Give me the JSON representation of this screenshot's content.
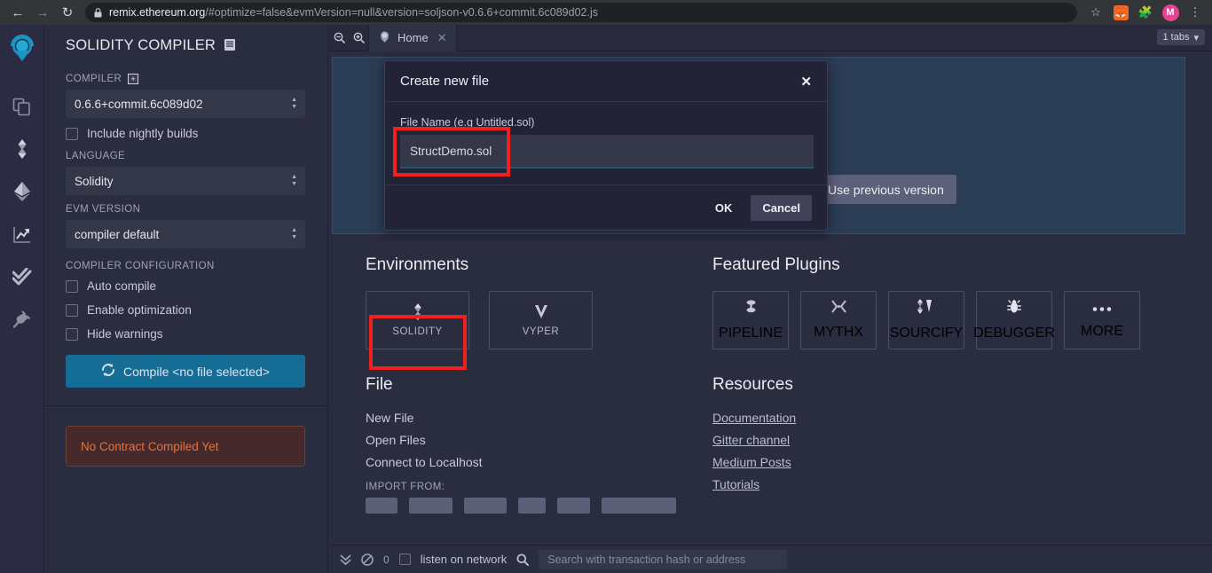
{
  "browser": {
    "back_icon": "back-arrow-icon",
    "forward_icon": "forward-arrow-icon",
    "reload_icon": "reload-icon",
    "lock_icon": "lock-icon",
    "url_host": "remix.ethereum.org",
    "url_rest": "/#optimize=false&evmVersion=null&version=soljson-v0.6.6+commit.6c089d02.js",
    "bookmark_icon": "star-icon",
    "metamask_icon": "metamask-fox-icon",
    "extensions_icon": "puzzle-piece-icon",
    "profile_initial": "M",
    "menu_icon": "kebab-menu-icon"
  },
  "rail": {
    "logo": "remix-logo-icon",
    "items": [
      {
        "name": "file-explorers",
        "icon": "files-icon"
      },
      {
        "name": "solidity-compiler",
        "icon": "solidity-icon"
      },
      {
        "name": "deploy-run-transactions",
        "icon": "ethereum-icon"
      },
      {
        "name": "solidity-static-analysis",
        "icon": "analytics-chart-icon"
      },
      {
        "name": "solidity-unit-testing",
        "icon": "double-check-icon"
      },
      {
        "name": "plugin-manager",
        "icon": "plug-icon"
      }
    ]
  },
  "panel": {
    "title": "SOLIDITY COMPILER",
    "title_icon": "book-doc-icon",
    "compiler_label": "COMPILER",
    "compiler_label_icon": "plus-box-icon",
    "compiler_value": "0.6.6+commit.6c089d02",
    "nightly_label": "Include nightly builds",
    "nightly_checked": false,
    "language_label": "LANGUAGE",
    "language_value": "Solidity",
    "evm_label": "EVM VERSION",
    "evm_value": "compiler default",
    "config_label": "COMPILER CONFIGURATION",
    "config_options": [
      {
        "label": "Auto compile",
        "checked": false
      },
      {
        "label": "Enable optimization",
        "checked": false
      },
      {
        "label": "Hide warnings",
        "checked": false
      }
    ],
    "compile_icon": "refresh-icon",
    "compile_label": "Compile <no file selected>",
    "status_text": "No Contract Compiled Yet"
  },
  "tabbar": {
    "zoom_out_icon": "zoom-out-icon",
    "zoom_in_icon": "zoom-in-icon",
    "tab_icon": "remix-home-icon",
    "tab_label": "Home",
    "tab_close_icon": "close-icon",
    "tabs_count_label": "1 tabs",
    "tabs_caret_icon": "chevron-down-icon"
  },
  "home": {
    "banner_button": "Use previous version",
    "environments": {
      "heading": "Environments",
      "cards": [
        {
          "label": "SOLIDITY",
          "icon": "solidity-icon",
          "highlighted": true
        },
        {
          "label": "VYPER",
          "icon": "vyper-icon",
          "highlighted": false
        }
      ]
    },
    "featured_plugins": {
      "heading": "Featured Plugins",
      "cards": [
        {
          "label": "PIPELINE",
          "icon": "pipeline-icon"
        },
        {
          "label": "MYTHX",
          "icon": "mythx-icon"
        },
        {
          "label": "SOURCIFY",
          "icon": "sourcify-icon"
        },
        {
          "label": "DEBUGGER",
          "icon": "bug-icon"
        },
        {
          "label": "MORE",
          "icon": "ellipsis-icon"
        }
      ]
    },
    "file": {
      "heading": "File",
      "items": [
        "New File",
        "Open Files",
        "Connect to Localhost"
      ],
      "import_label": "IMPORT FROM:",
      "import_buttons": [
        "",
        "",
        "",
        "",
        "",
        ""
      ]
    },
    "resources": {
      "heading": "Resources",
      "links": [
        "Documentation",
        "Gitter channel",
        "Medium Posts",
        "Tutorials"
      ]
    }
  },
  "terminal": {
    "collapse_icon": "double-chevron-down-icon",
    "clear_icon": "no-entry-icon",
    "count": "0",
    "listen_checked": false,
    "listen_label": "listen on network",
    "search_icon": "search-icon",
    "search_placeholder": "Search with transaction hash or address"
  },
  "modal": {
    "title": "Create new file",
    "close_icon": "close-icon",
    "field_label": "File Name (e.g Untitled.sol)",
    "input_value": "StructDemo.sol",
    "ok_label": "OK",
    "cancel_label": "Cancel"
  },
  "colors": {
    "accent_teal": "#156c95",
    "highlight_red": "#f21f1f",
    "warn_orange": "#e8713c",
    "panel_bg": "#2a2c3f",
    "modal_bg": "#222336",
    "banner_bg": "#2b3c55"
  }
}
